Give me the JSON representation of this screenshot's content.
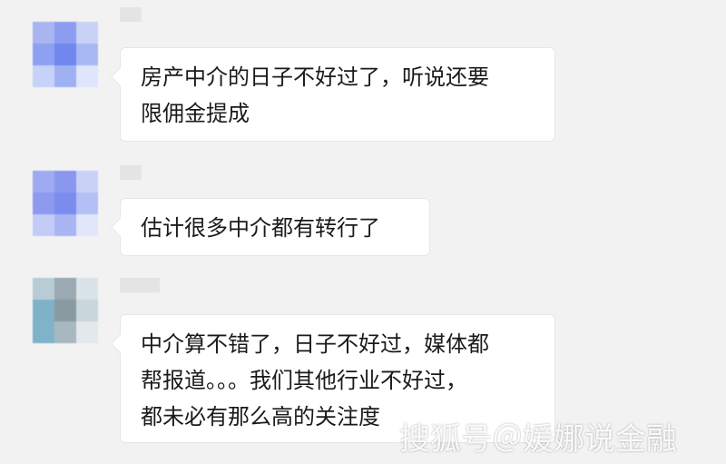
{
  "messages": [
    {
      "text": "房产中介的日子不好过了，听说还要\n限佣金提成",
      "avatar_colors": [
        "#a9b5f0",
        "#8c9cf0",
        "#c8d2f7",
        "#8ea0f2",
        "#6f87ee",
        "#a7b9f4",
        "#c6d2f7",
        "#9fb1f3",
        "#dfe5fa"
      ]
    },
    {
      "text": "估计很多中介都有转行了",
      "avatar_colors": [
        "#9eaaf1",
        "#8a97ef",
        "#c9d1f6",
        "#8d9af0",
        "#7a8cee",
        "#b3c0f5",
        "#c2ccf6",
        "#a9b6f3",
        "#e2e6fa"
      ]
    },
    {
      "text": "中介算不错了，日子不好过，媒体都\n帮报道。。。我们其他行业不好过，\n都未必有那么高的关注度",
      "avatar_colors": [
        "#b8ccd6",
        "#9aa9b2",
        "#d9e3e8",
        "#7fb2c8",
        "#8a9aa3",
        "#c9d6dc",
        "#7fb3c9",
        "#a8b8c0",
        "#e2e8eb"
      ]
    }
  ],
  "watermark": "搜狐号＠媛娜说金融"
}
